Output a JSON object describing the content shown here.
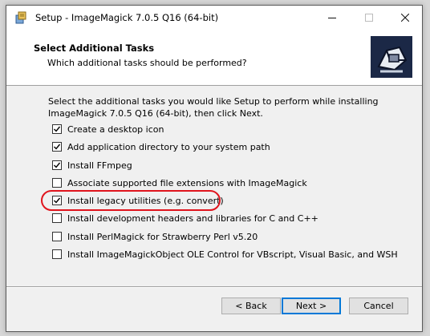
{
  "window": {
    "title": "Setup - ImageMagick 7.0.5 Q16 (64-bit)",
    "icon": "setup-installer-icon",
    "controls": [
      "minimize-icon",
      "maximize-icon",
      "close-icon"
    ]
  },
  "header": {
    "title": "Select Additional Tasks",
    "subtitle": "Which additional tasks should be performed?",
    "logo": "imagemagick-wizard-logo"
  },
  "instructions": "Select the additional tasks you would like Setup to perform while installing ImageMagick 7.0.5 Q16 (64-bit), then click Next.",
  "tasks": [
    {
      "label": "Create a desktop icon",
      "checked": true
    },
    {
      "label": "Add application directory to your system path",
      "checked": true
    },
    {
      "label": "Install FFmpeg",
      "checked": true
    },
    {
      "label": "Associate supported file extensions with ImageMagick",
      "checked": false
    },
    {
      "label": "Install legacy utilities (e.g. convert)",
      "checked": true,
      "highlighted": true
    },
    {
      "label": "Install development headers and libraries for C and C++",
      "checked": false
    },
    {
      "label": "Install PerlMagick for Strawberry Perl v5.20",
      "checked": false
    },
    {
      "label": "Install ImageMagickObject OLE Control for VBscript, Visual Basic, and WSH",
      "checked": false
    }
  ],
  "buttons": {
    "back": "< Back",
    "next": "Next >",
    "cancel": "Cancel"
  },
  "colors": {
    "highlight_ring": "#e0141d",
    "default_button_border": "#0078d7",
    "logo_background": "#1b2846"
  }
}
